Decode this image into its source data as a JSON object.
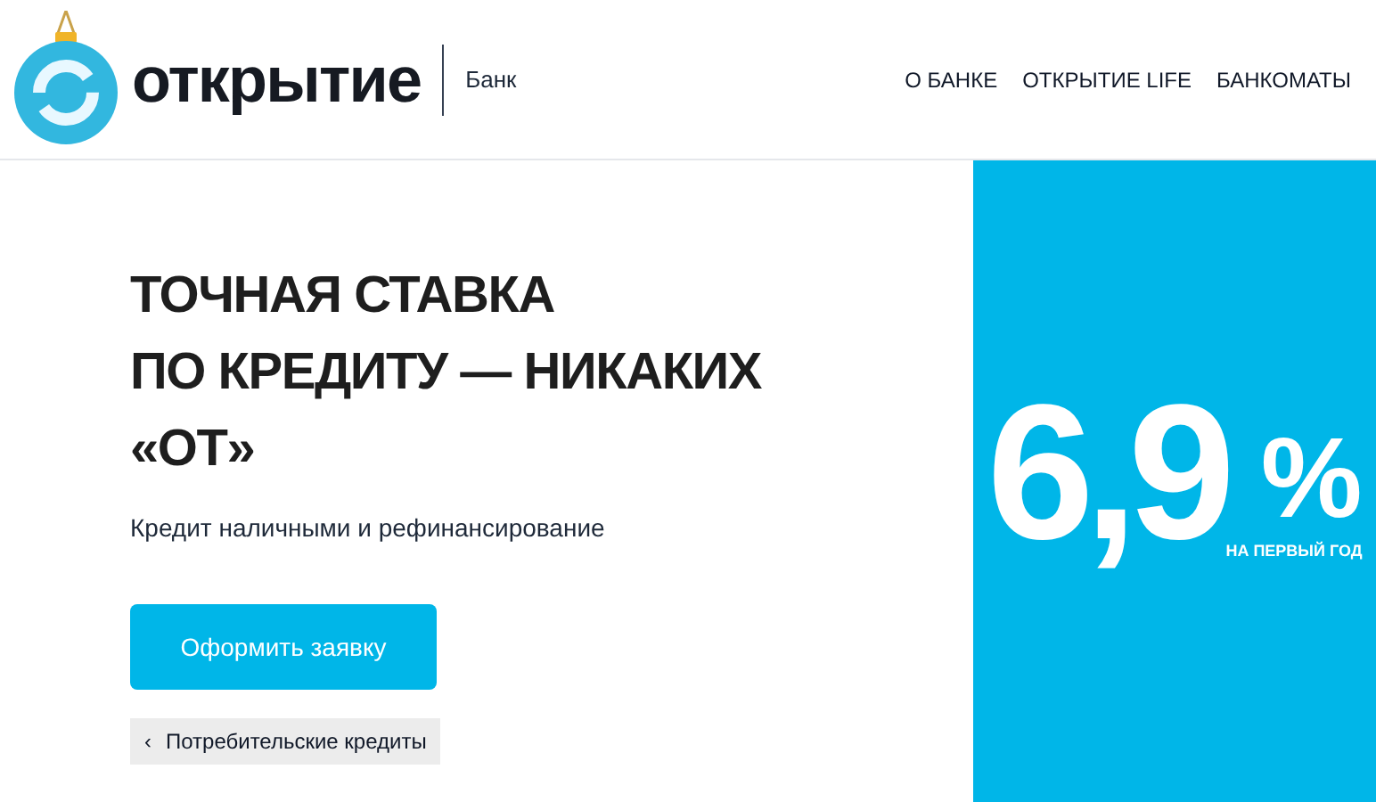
{
  "header": {
    "logo_text": "открытие",
    "logo_subtitle": "Банк",
    "nav": [
      "О БАНКЕ",
      "ОТКРЫТИЕ LIFE",
      "БАНКОМАТЫ"
    ]
  },
  "hero": {
    "headline": [
      "ТОЧНАЯ СТАВКА",
      "ПО КРЕДИТУ — НИКАКИХ",
      "«ОТ»"
    ],
    "subtitle": "Кредит наличными и рефинансирование",
    "apply_button": "Оформить заявку",
    "breadcrumb": {
      "icon": "‹",
      "label": "Потребительские кредиты"
    }
  },
  "rate_panel": {
    "rate": "6,9",
    "percent": "%",
    "caption": "НА ПЕРВЫЙ ГОД"
  }
}
